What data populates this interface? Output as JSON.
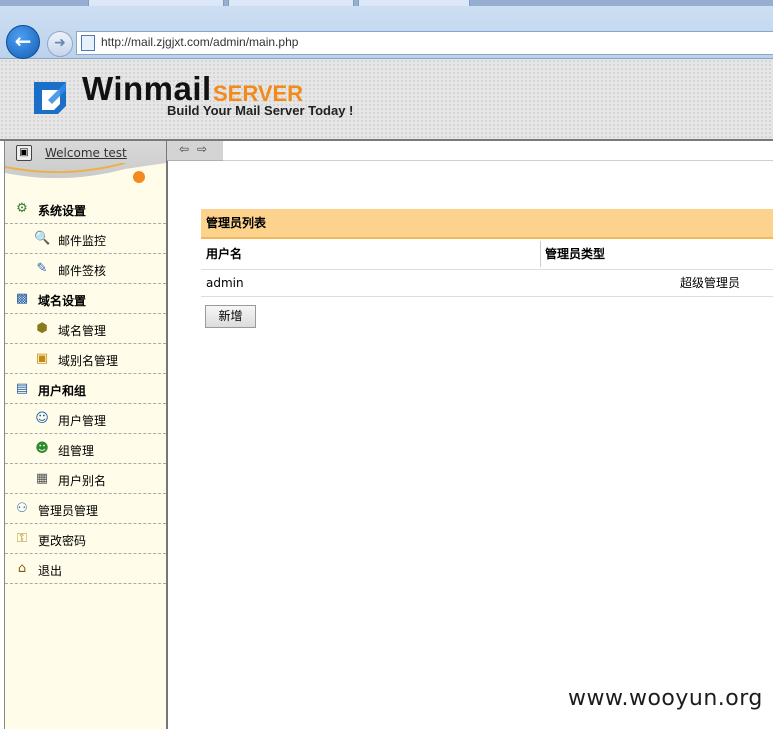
{
  "browser": {
    "url": "http://mail.zjgjxt.com/admin/main.php"
  },
  "header": {
    "logo_main": "Winmail",
    "logo_accent": "SERVER",
    "tagline": "Build Your Mail Server Today !"
  },
  "sidebar": {
    "welcome": "Welcome test",
    "items": [
      {
        "label": "系统设置",
        "icon": "system-settings-icon",
        "level": "top",
        "bold": true
      },
      {
        "label": "邮件监控",
        "icon": "mail-monitor-icon",
        "level": "sub"
      },
      {
        "label": "邮件签核",
        "icon": "mail-approval-icon",
        "level": "sub"
      },
      {
        "label": "域名设置",
        "icon": "domain-settings-icon",
        "level": "top",
        "bold": true
      },
      {
        "label": "域名管理",
        "icon": "domain-manage-icon",
        "level": "sub"
      },
      {
        "label": "域别名管理",
        "icon": "domain-alias-icon",
        "level": "sub"
      },
      {
        "label": "用户和组",
        "icon": "users-groups-icon",
        "level": "top",
        "bold": true
      },
      {
        "label": "用户管理",
        "icon": "user-manage-icon",
        "level": "sub"
      },
      {
        "label": "组管理",
        "icon": "group-manage-icon",
        "level": "sub"
      },
      {
        "label": "用户别名",
        "icon": "user-alias-icon",
        "level": "sub"
      },
      {
        "label": "管理员管理",
        "icon": "admin-manage-icon",
        "level": "top"
      },
      {
        "label": "更改密码",
        "icon": "password-key-icon",
        "level": "top"
      },
      {
        "label": "退出",
        "icon": "home-icon",
        "level": "top"
      }
    ]
  },
  "main": {
    "panel_title": "管理员列表",
    "columns": [
      "用户名",
      "管理员类型"
    ],
    "rows": [
      {
        "username": "admin",
        "type": "超级管理员"
      }
    ],
    "add_button": "新增"
  },
  "watermark": "www.wooyun.org",
  "colors": {
    "panel_header": "#fdd28d",
    "logo_accent": "#f28b1c",
    "sidebar_bg": "#fffde9"
  }
}
